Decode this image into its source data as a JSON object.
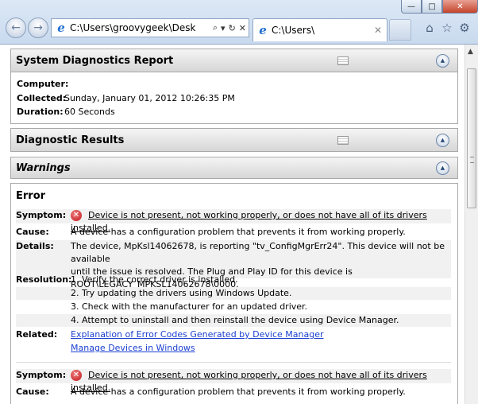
{
  "window": {
    "minimize": "—",
    "maximize": "□",
    "close": "✕"
  },
  "browser": {
    "address": "C:\\Users\\groovygeek\\Desk",
    "search_glyph": "⌕",
    "dropdown_glyph": "▾",
    "refresh_glyph": "↻",
    "stop_glyph": "✕",
    "tab_title": "C:\\Users\\",
    "tab_close": "✕",
    "back_glyph": "←",
    "forward_glyph": "→",
    "home_glyph": "⌂",
    "favorites_glyph": "☆",
    "tools_glyph": "⚙"
  },
  "report": {
    "title": "System Diagnostics Report",
    "computer_label": "Computer:",
    "computer_value": "",
    "collected_label": "Collected:",
    "collected_value": "Sunday, January 01, 2012 10:26:35 PM",
    "duration_label": "Duration:",
    "duration_value": "60 Seconds"
  },
  "sections": {
    "diagnostic_results": "Diagnostic Results",
    "warnings": "Warnings",
    "error": "Error"
  },
  "labels": {
    "symptom": "Symptom:",
    "cause": "Cause:",
    "details": "Details:",
    "resolution": "Resolution:",
    "related": "Related:"
  },
  "error1": {
    "symptom": "Device is not present, not working properly, or does not have all of its drivers installed.",
    "cause": "A device has a configuration problem that prevents it from working properly.",
    "details_1": "The device, MpKsl14062678, is reporting \"tv_ConfigMgrErr24\". This device will not be available",
    "details_2": "until the issue is resolved. The Plug and Play ID for this device is",
    "details_3": "ROOT\\LEGACY_MPKSL14062678\\0000.",
    "resolution_1": "1. Verify the correct driver is installed.",
    "resolution_2": "2. Try updating the drivers using Windows Update.",
    "resolution_3": "3. Check with the manufacturer for an updated driver.",
    "resolution_4": "4. Attempt to uninstall and then reinstall the device using Device Manager.",
    "related_1": "Explanation of Error Codes Generated by Device Manager",
    "related_2": "Manage Devices in Windows"
  },
  "error2": {
    "symptom": "Device is not present, not working properly, or does not have all of its drivers installed.",
    "cause": "A device has a configuration problem that prevents it from working properly."
  },
  "icons": {
    "error_glyph": "✕",
    "collapse_glyph": "▲"
  }
}
